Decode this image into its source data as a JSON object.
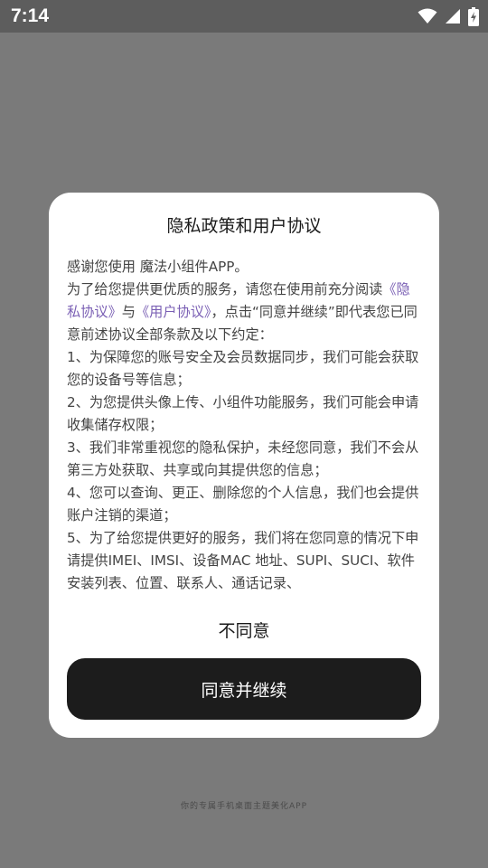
{
  "status_bar": {
    "time": "7:14",
    "icons": [
      "wifi-icon",
      "cellular-signal-icon",
      "battery-charging-icon"
    ]
  },
  "dialog": {
    "title": "隐私政策和用户协议",
    "intro": "感谢您使用 魔法小组件APP。",
    "para_prefix": "为了给您提供更优质的服务，请您在使用前充分阅读",
    "privacy_link": "《隐私协议》",
    "connector": "与",
    "user_link": "《用户协议》",
    "para_suffix": "，点击“同意并继续”即代表您已同意前述协议全部条款及以下约定：",
    "items": [
      "1、为保障您的账号安全及会员数据同步，我们可能会获取您的设备号等信息；",
      "2、为您提供头像上传、小组件功能服务，我们可能会申请收集储存权限；",
      "3、我们非常重视您的隐私保护，未经您同意，我们不会从第三方处获取、共享或向其提供您的信息；",
      "4、您可以查询、更正、删除您的个人信息，我们也会提供账户注销的渠道；",
      "5、为了给您提供更好的服务，我们将在您同意的情况下申请提供IMEI、IMSI、设备MAC 地址、SUPI、SUCI、软件安装列表、位置、联系人、通话记录、"
    ],
    "disagree_label": "不同意",
    "agree_label": "同意并继续"
  },
  "footer": {
    "tagline": "你的专属手机桌面主题美化APP"
  },
  "colors": {
    "overlay": "#7a7a7a",
    "status_bar": "#5d5d5d",
    "link": "#7a5fb4",
    "primary_button": "#1c1c1c"
  }
}
